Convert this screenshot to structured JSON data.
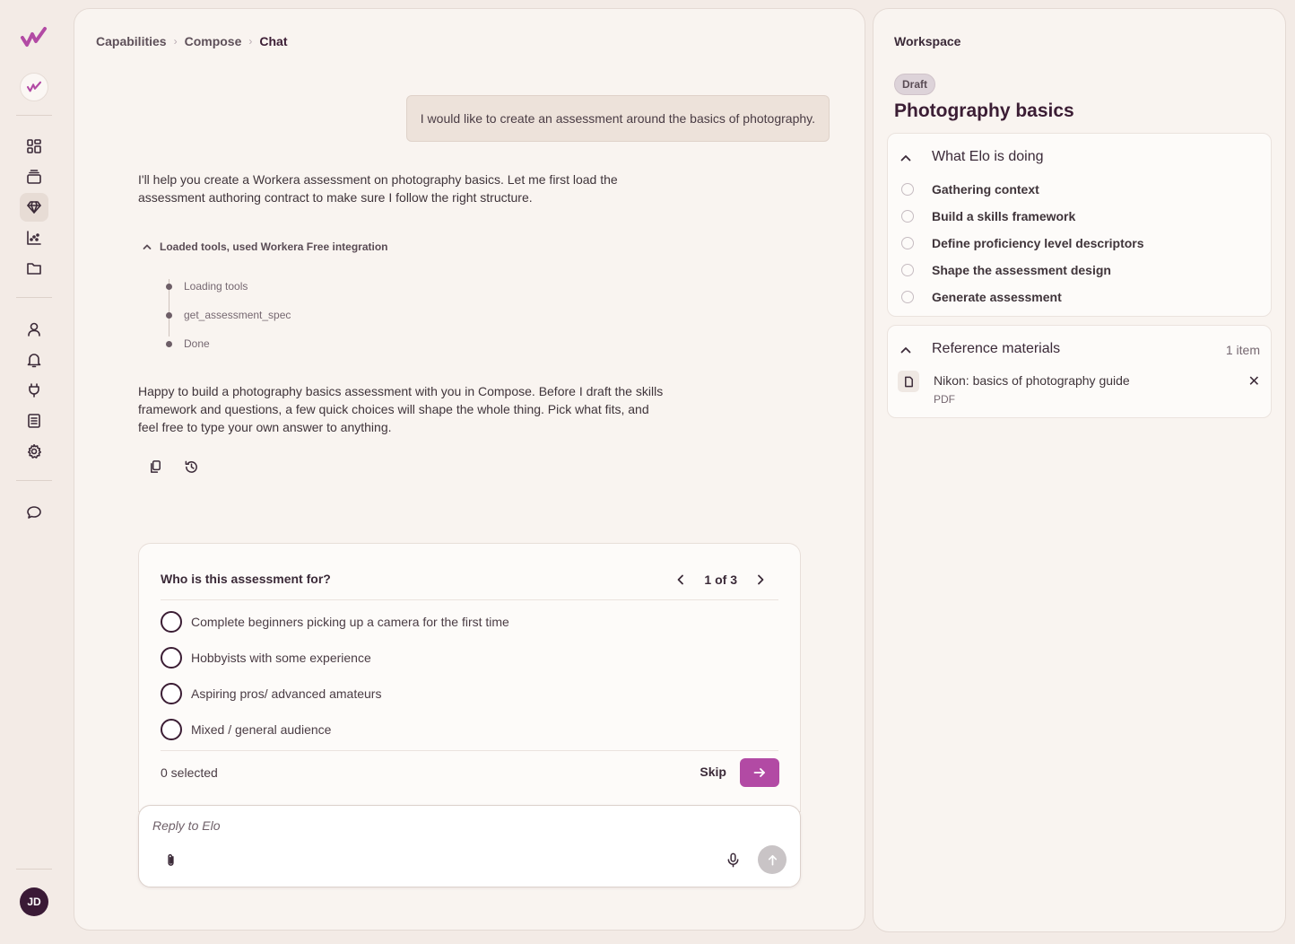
{
  "sidebar": {
    "user_initials": "JD",
    "nav_icons": [
      "dashboard-icon",
      "stack-icon",
      "gem-icon",
      "analytics-icon",
      "folder-icon",
      "user-icon",
      "bell-icon",
      "plug-icon",
      "list-icon",
      "gear-icon",
      "chat-icon"
    ],
    "active_item": "gem-icon",
    "brand_color": "#b24aa4"
  },
  "breadcrumb": {
    "items": [
      "Capabilities",
      "Compose",
      "Chat"
    ]
  },
  "chat": {
    "user_message": "I would like to create an assessment around the basics of photography.",
    "assistant_intro": "I'll help you create a Workera assessment on photography basics. Let me first load the assessment authoring contract to make sure I follow the right structure.",
    "tools_summary": "Loaded tools, used Workera Free integration",
    "tool_steps": [
      "Loading tools",
      "get_assessment_spec",
      "Done"
    ],
    "assistant_followup": "Happy to build a photography basics assessment with you in Compose. Before I draft the skills framework and questions, a few quick choices will shape the whole thing. Pick what fits, and feel free to type your own answer to anything."
  },
  "question": {
    "title": "Who is this assessment for?",
    "pager": "1 of 3",
    "options": [
      "Complete beginners picking up a camera for the first time",
      "Hobbyists with some experience",
      "Aspiring pros/ advanced amateurs",
      "Mixed / general audience"
    ],
    "selected_text": "0 selected",
    "skip_label": "Skip"
  },
  "reply": {
    "placeholder": "Reply to Elo"
  },
  "workspace": {
    "header": "Workspace",
    "badge": "Draft",
    "title": "Photography basics",
    "doing_title": "What Elo is doing",
    "steps": [
      "Gathering context",
      "Build a skills framework",
      "Define proficiency level descriptors",
      "Shape the assessment design",
      "Generate assessment"
    ],
    "reference_title": "Reference materials",
    "reference_count": "1 item",
    "reference_items": [
      {
        "name": "Nikon: basics of photography guide",
        "type": "PDF"
      }
    ]
  }
}
